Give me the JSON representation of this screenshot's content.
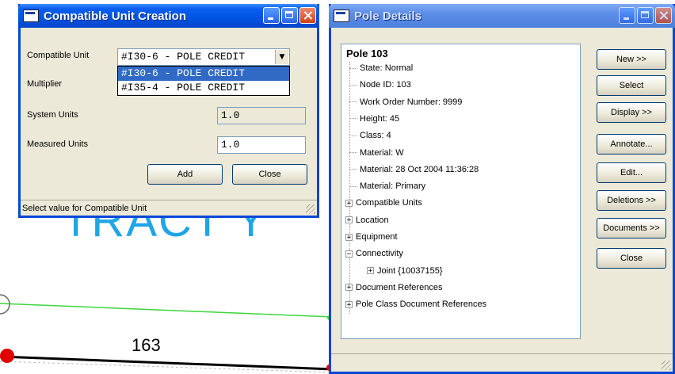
{
  "background": {
    "tract_text": "TRACT Y",
    "pole_label": "163"
  },
  "compatible_dialog": {
    "title": "Compatible Unit Creation",
    "labels": {
      "compatible_unit": "Compatible Unit",
      "multiplier": "Multiplier",
      "system_units": "System Units",
      "measured_units": "Measured Units"
    },
    "combo_value": "#I30-6 - POLE CREDIT",
    "dropdown_options": [
      {
        "text": "#I30-6 - POLE CREDIT",
        "selected": true
      },
      {
        "text": "#I35-4 - POLE CREDIT",
        "selected": false
      }
    ],
    "system_units_value": "1.0",
    "measured_units_value": "1.0",
    "buttons": {
      "add": "Add",
      "close": "Close"
    },
    "status": "Select value for Compatible Unit"
  },
  "pole_dialog": {
    "title": "Pole Details",
    "tree_root": "Pole 103",
    "tree_items": [
      {
        "text": "State: Normal",
        "expander": ""
      },
      {
        "text": "Node ID: 103",
        "expander": ""
      },
      {
        "text": "Work Order Number: 9999",
        "expander": ""
      },
      {
        "text": "Height:  45",
        "expander": ""
      },
      {
        "text": "Class:  4",
        "expander": ""
      },
      {
        "text": "Material: W",
        "expander": ""
      },
      {
        "text": "Material: 28 Oct 2004 11:36:28",
        "expander": ""
      },
      {
        "text": "Material: Primary",
        "expander": ""
      },
      {
        "text": "Compatible Units",
        "expander": "+"
      },
      {
        "text": "Location",
        "expander": "+"
      },
      {
        "text": "Equipment",
        "expander": "+"
      },
      {
        "text": "Connectivity",
        "expander": "−"
      },
      {
        "text": "Document References",
        "expander": "+"
      },
      {
        "text": "Pole Class Document References",
        "expander": "+"
      }
    ],
    "sub_item": {
      "text": "Joint {10037155}",
      "expander": "+"
    },
    "buttons": {
      "new": "New >>",
      "select": "Select",
      "display": "Display >>",
      "annotate": "Annotate...",
      "edit": "Edit...",
      "deletions": "Deletions >>",
      "documents": "Documents >>",
      "close": "Close"
    }
  },
  "colors": {
    "title_active": "#0054e3",
    "title_inactive": "#7fa9f4",
    "selection": "#316ac5",
    "tract_text": "#1fa5e6",
    "green_line": "#3cd63c",
    "red_marker": "#e00000"
  }
}
